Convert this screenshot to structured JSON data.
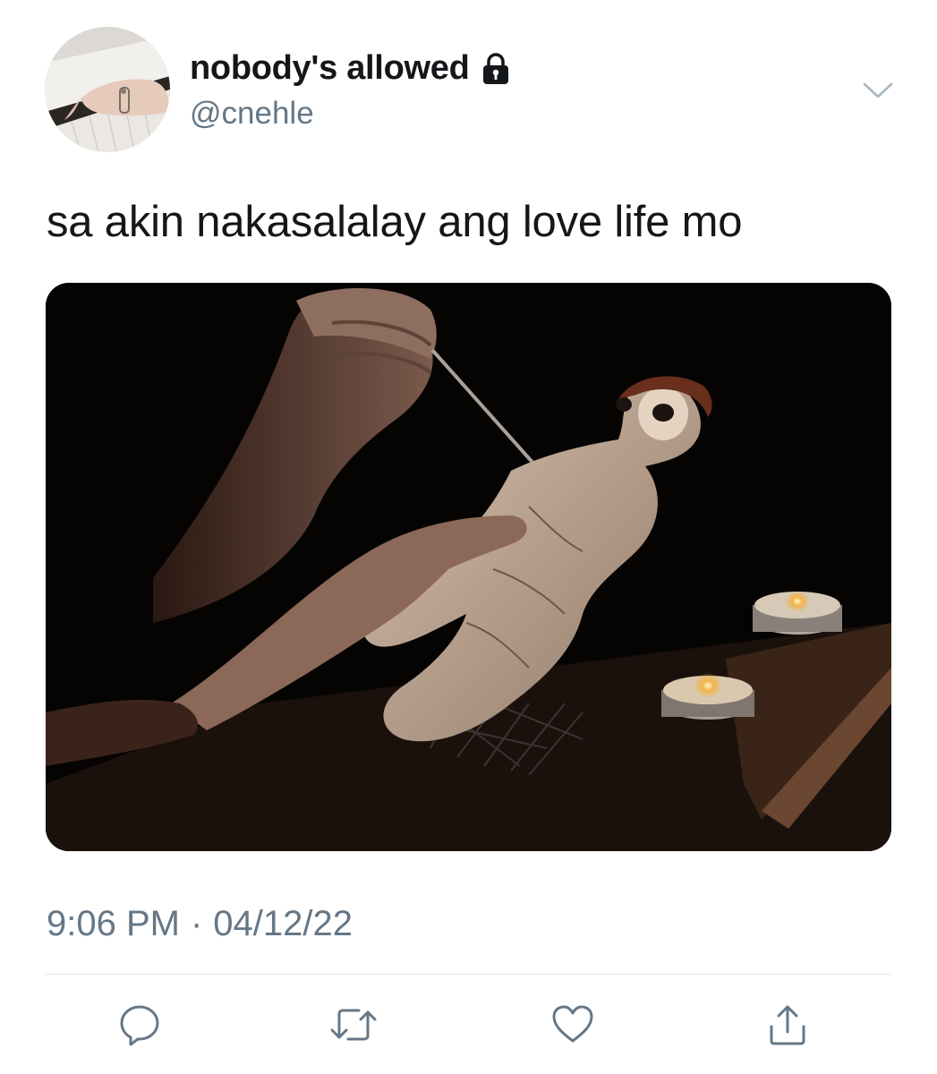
{
  "header": {
    "display_name": "nobody's allowed",
    "handle": "@cnehle",
    "protected_icon": "lock-icon",
    "menu_icon": "chevron-down-icon",
    "avatar_image": "hands-playing-piano"
  },
  "tweet": {
    "text": "sa akin nakasalalay ang love life mo",
    "media_description": "voodoo-doll-with-needle-and-candles"
  },
  "meta": {
    "time": "9:06 PM",
    "separator": "·",
    "date": "04/12/22"
  },
  "actions": [
    {
      "name": "reply",
      "icon": "reply-icon"
    },
    {
      "name": "retweet",
      "icon": "retweet-icon"
    },
    {
      "name": "like",
      "icon": "heart-icon"
    },
    {
      "name": "share",
      "icon": "share-icon"
    }
  ],
  "colors": {
    "text_primary": "#14171a",
    "text_secondary": "#657786",
    "divider": "#e1e8ed",
    "icon": "#657786"
  }
}
